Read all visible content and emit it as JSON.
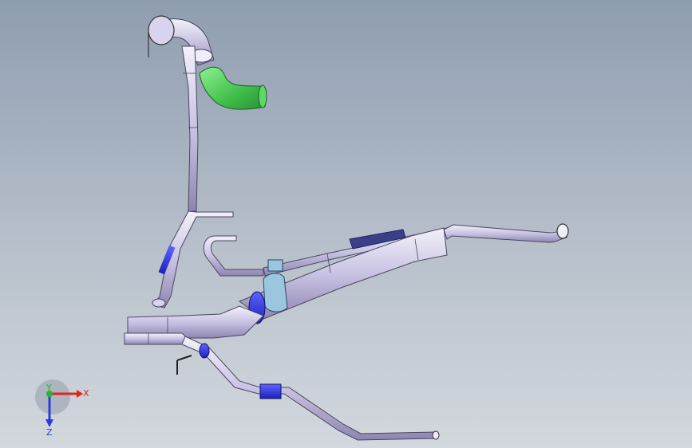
{
  "triad": {
    "x_label": "X",
    "y_label": "Y",
    "z_label": "Z",
    "x_color": "#e0251b",
    "y_color": "#2bb236",
    "z_color": "#2a3bd8"
  },
  "colors": {
    "background_top": "#8f9db0",
    "background_bottom": "#d3d8de",
    "pipe": "#cfc9e6",
    "pipe_edge": "#4a4660",
    "selected_part": "#4fc95a",
    "clamp_blue": "#2c2fd6",
    "bracket": "#9cc6e0"
  },
  "icons": {
    "triad": "coordinate-triad-icon"
  }
}
